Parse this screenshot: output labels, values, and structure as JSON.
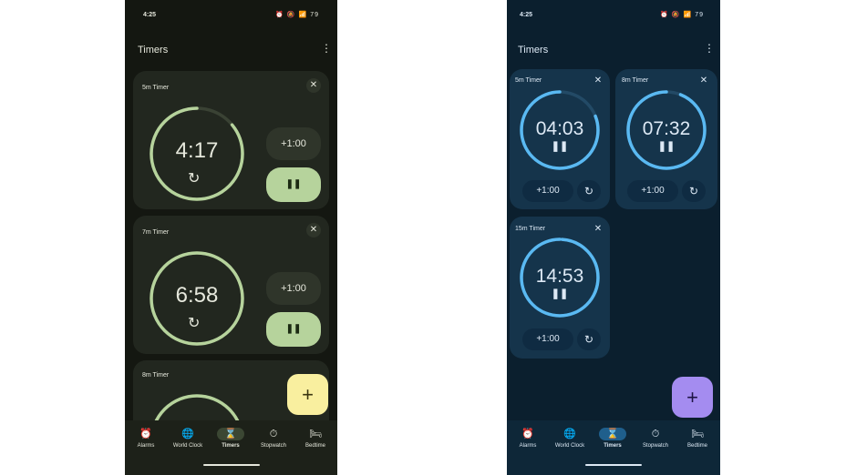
{
  "light_screen": {
    "status_time": "4:25",
    "status_icons": "⏰ 🔕 📶 79",
    "page_title": "Timers",
    "more_icon": "more-vert-icon",
    "timers": [
      {
        "label": "5m Timer",
        "time": "4:17",
        "add_label": "+1:00",
        "progress": 0.86
      },
      {
        "label": "7m Timer",
        "time": "6:58",
        "add_label": "+1:00",
        "progress": 1.0
      },
      {
        "label": "8m Timer"
      }
    ],
    "nav": [
      {
        "label": "Alarms",
        "icon": "⏰"
      },
      {
        "label": "World Clock",
        "icon": "🌐"
      },
      {
        "label": "Timers",
        "icon": "⌛"
      },
      {
        "label": "Stopwatch",
        "icon": "⏱"
      },
      {
        "label": "Bedtime",
        "icon": "🛏"
      }
    ],
    "fab_label": "+",
    "colors": {
      "accent": "#b6d39c",
      "fab": "#f9ef9f"
    }
  },
  "dark_screen": {
    "status_time": "4:25",
    "status_icons": "⏰ 🔕 📶 79",
    "page_title": "Timers",
    "more_icon": "more-vert-icon",
    "timers": [
      {
        "label": "5m Timer",
        "time": "04:03",
        "add_label": "+1:00",
        "progress": 0.81
      },
      {
        "label": "8m Timer",
        "time": "07:32",
        "add_label": "+1:00",
        "progress": 0.94
      },
      {
        "label": "15m Timer",
        "time": "14:53",
        "add_label": "+1:00",
        "progress": 0.99
      }
    ],
    "nav": [
      {
        "label": "Alarms",
        "icon": "⏰"
      },
      {
        "label": "World Clock",
        "icon": "🌐"
      },
      {
        "label": "Timers",
        "icon": "⌛"
      },
      {
        "label": "Stopwatch",
        "icon": "⏱"
      },
      {
        "label": "Bedtime",
        "icon": "🛏"
      }
    ],
    "fab_label": "+",
    "colors": {
      "accent": "#5ab9f2",
      "fab": "#a48cf0"
    }
  }
}
